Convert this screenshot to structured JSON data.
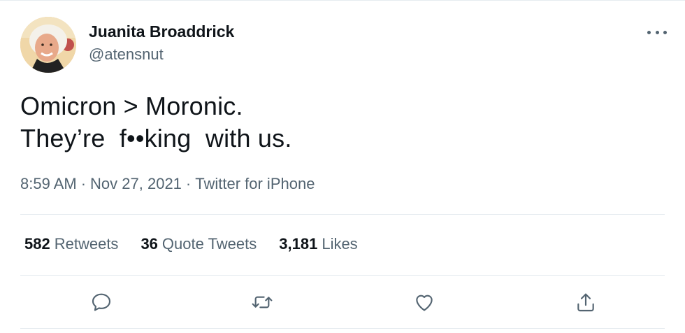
{
  "author": {
    "name": "Juanita Broaddrick",
    "handle": "@atensnut",
    "avatar_icon": "profile-photo"
  },
  "tweet": {
    "text_line1": "Omicron > Moronic.",
    "text_line2": "They’re  f••king  with us."
  },
  "meta": {
    "time": "8:59 AM",
    "separator": "·",
    "date": "Nov 27, 2021",
    "source": "Twitter for iPhone"
  },
  "stats": {
    "retweets_count": "582",
    "retweets_label": "Retweets",
    "quotes_count": "36",
    "quotes_label": "Quote Tweets",
    "likes_count": "3,181",
    "likes_label": "Likes"
  },
  "actions": {
    "reply_icon": "reply-icon",
    "retweet_icon": "retweet-icon",
    "like_icon": "heart-icon",
    "share_icon": "share-icon",
    "more_icon": "more-icon"
  },
  "colors": {
    "text": "#0f1419",
    "secondary": "#536471",
    "divider": "#e6ecf0"
  }
}
